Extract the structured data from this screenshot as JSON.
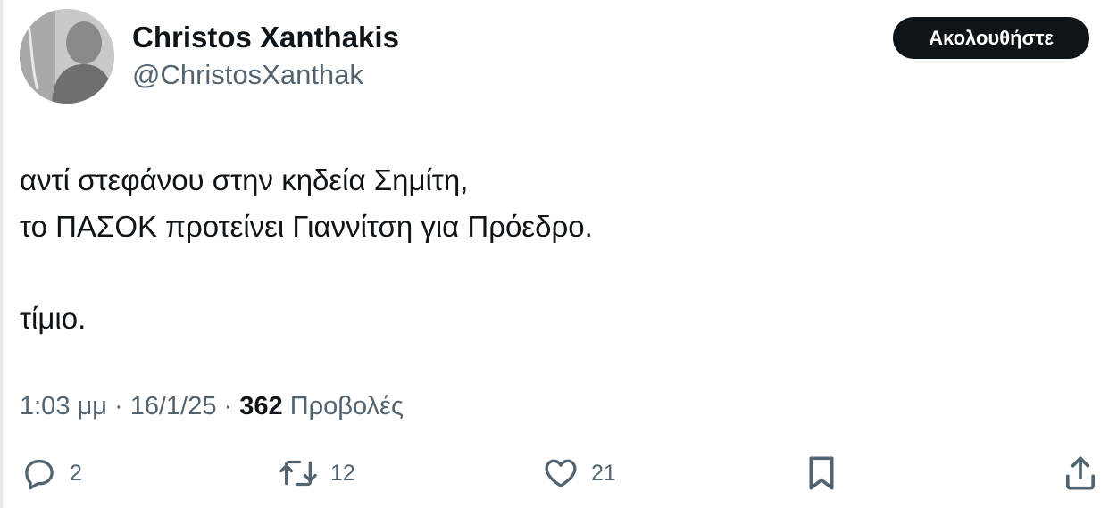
{
  "author": {
    "display_name": "Christos Xanthakis",
    "handle": "@ChristosXanthak"
  },
  "follow_button": {
    "label": "Ακολουθήστε"
  },
  "tweet": {
    "lines": [
      "αντί στεφάνου στην κηδεία Σημίτη,",
      "το ΠΑΣΟΚ προτείνει Γιαννίτση για Πρόεδρο.",
      "τίμιο."
    ]
  },
  "meta": {
    "time": "1:03 μμ",
    "separator": "·",
    "date": "16/1/25",
    "views_count": "362",
    "views_label": "Προβολές"
  },
  "actions": {
    "reply": {
      "icon": "reply-icon",
      "count": "2"
    },
    "retweet": {
      "icon": "retweet-icon",
      "count": "12"
    },
    "like": {
      "icon": "heart-icon",
      "count": "21"
    },
    "bookmark": {
      "icon": "bookmark-icon"
    },
    "share": {
      "icon": "share-icon"
    }
  },
  "colors": {
    "text_primary": "#0f1419",
    "text_secondary": "#536471",
    "button_bg": "#0f1419",
    "button_text": "#ffffff",
    "background": "#ffffff"
  }
}
